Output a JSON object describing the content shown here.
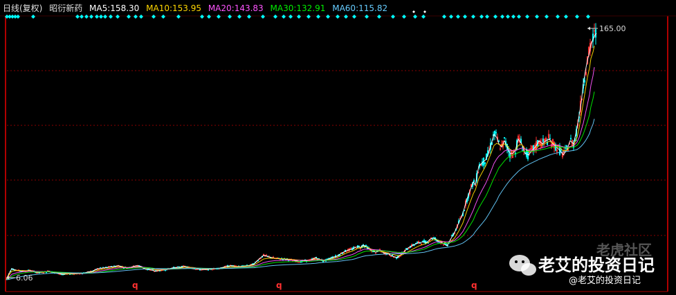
{
  "header": {
    "period_label": "日线(复权)",
    "stock_name": "昭衍新药",
    "ma": [
      {
        "label": "MA5:",
        "value": "158.30",
        "color": "#ffffff"
      },
      {
        "label": "MA10:",
        "value": "153.95",
        "color": "#ffd700"
      },
      {
        "label": "MA20:",
        "value": "143.83",
        "color": "#ff55ff"
      },
      {
        "label": "MA30:",
        "value": "132.91",
        "color": "#00ee00"
      },
      {
        "label": "MA60:",
        "value": "115.82",
        "color": "#66ccff"
      }
    ]
  },
  "price_labels": {
    "high": "165.00",
    "low": "6.06"
  },
  "markers": {
    "q1": "q",
    "q2": "q",
    "q3": "q"
  },
  "watermark": {
    "brand": "老虎社区",
    "title": "老艾的投资日记",
    "handle": "@老艾的投资日记"
  },
  "colors": {
    "background": "#000000",
    "grid": "#8b0000",
    "axis": "#b00000",
    "up": "#ff3030",
    "down": "#00ffff",
    "signal": "#00ffff"
  },
  "chart_data": {
    "type": "line",
    "title": "",
    "xlabel": "",
    "ylabel": "",
    "ylim": [
      0,
      175
    ],
    "grid": true,
    "legend": "top-left",
    "x": [
      0,
      4,
      8,
      15,
      25,
      35,
      45,
      55,
      62,
      70,
      82,
      90,
      100,
      110,
      118,
      125,
      132,
      140,
      148,
      156,
      162,
      170,
      175,
      180,
      188,
      195,
      200,
      207,
      212,
      215,
      222,
      230,
      240,
      250,
      258,
      262,
      270,
      280,
      290,
      300,
      310,
      318,
      325,
      332,
      340,
      350,
      358,
      365,
      372,
      380,
      390,
      405,
      425,
      440,
      447,
      452,
      458,
      463,
      470,
      478,
      485,
      492,
      500,
      505,
      508,
      512,
      516,
      520,
      528,
      534,
      540,
      546,
      552,
      558,
      565,
      572,
      580,
      588,
      596,
      604,
      608,
      612,
      616,
      620,
      624,
      630,
      637,
      642,
      648,
      654,
      660,
      665,
      670,
      675,
      678,
      683,
      688,
      693,
      697,
      701,
      705,
      709,
      712,
      716,
      720,
      724,
      728,
      732,
      736,
      740,
      745,
      750,
      755,
      760,
      765,
      770,
      775,
      780,
      785,
      790,
      795,
      800,
      805,
      810,
      815,
      820,
      825,
      828,
      831,
      834,
      837,
      840,
      843,
      845,
      848,
      850,
      853
    ],
    "series": [
      {
        "name": "MA5",
        "values": [
          6.06,
          10,
          13,
          12,
          11.5,
          12,
          10.5,
          11,
          11.5,
          10.5,
          9.5,
          9.8,
          10,
          10,
          11,
          11.5,
          13,
          13.5,
          14,
          14.5,
          15,
          14,
          13.5,
          14,
          15,
          14.5,
          13,
          12.5,
          12,
          11.5,
          12,
          12.5,
          13.5,
          14,
          14.5,
          14,
          13.5,
          12.5,
          12.5,
          13,
          13.5,
          14.5,
          15,
          14.5,
          14.5,
          15,
          16,
          19,
          21.5,
          20.5,
          19.5,
          19,
          17.5,
          18.5,
          20,
          19,
          18,
          18.5,
          20,
          21,
          23,
          24.5,
          25.5,
          26.5,
          27,
          26.5,
          28,
          27,
          24.5,
          23.5,
          24.5,
          23,
          22.5,
          21,
          20,
          22.5,
          26,
          28,
          29.5,
          30,
          29.5,
          31.5,
          32.5,
          32,
          30.5,
          29.5,
          27.5,
          31.5,
          36,
          42,
          48,
          56,
          62,
          68,
          66,
          78,
          80,
          82,
          86,
          92,
          98,
          96,
          92,
          90,
          94,
          90,
          86,
          86,
          88,
          95,
          92,
          86,
          85,
          88,
          90,
          94,
          92,
          94,
          95,
          92,
          90,
          88,
          85,
          88,
          94,
          92,
          102,
          110,
          118,
          130,
          138,
          145,
          150,
          155,
          158,
          160,
          162
        ]
      },
      {
        "name": "MA10",
        "values": [
          6.06,
          9,
          11.5,
          12,
          11.8,
          11.8,
          11,
          11,
          11.2,
          10.8,
          10,
          9.8,
          9.8,
          10,
          10.5,
          11,
          12,
          12.8,
          13.2,
          13.8,
          14.2,
          14,
          13.8,
          13.8,
          14.2,
          14.2,
          13.6,
          13.2,
          12.8,
          12.4,
          12.2,
          12.4,
          13,
          13.4,
          14,
          14,
          13.8,
          13.2,
          12.9,
          13,
          13.2,
          13.8,
          14.4,
          14.4,
          14.4,
          14.8,
          15.4,
          17.2,
          19.2,
          19.8,
          19.6,
          19.2,
          18.4,
          18.4,
          19.2,
          19,
          18.6,
          18.5,
          19.2,
          20,
          21.6,
          23,
          24.2,
          25.2,
          26,
          26.2,
          27,
          26.8,
          25.4,
          24.4,
          24.2,
          23.6,
          23,
          22.2,
          21.4,
          21.8,
          23.6,
          25.6,
          27.4,
          28.6,
          29.2,
          30.2,
          31.2,
          31.6,
          31,
          30.4,
          29.2,
          30,
          32.4,
          36.8,
          42,
          48.6,
          54.6,
          60.4,
          63,
          70,
          74,
          78,
          82,
          86.4,
          91,
          92.4,
          91.6,
          91,
          92,
          90.8,
          88.6,
          87.4,
          87.6,
          91,
          91.6,
          88.8,
          87,
          87.4,
          88.4,
          91,
          91.4,
          92.6,
          93.6,
          92.6,
          91.2,
          89.6,
          87.6,
          87.8,
          90.2,
          91,
          96,
          102,
          110,
          118,
          126,
          134,
          140,
          146,
          150,
          154
        ]
      },
      {
        "name": "MA20",
        "values": [
          6.06,
          7.5,
          9.5,
          10.5,
          11.2,
          11.5,
          11.3,
          11.2,
          11.2,
          11,
          10.6,
          10.3,
          10.1,
          10,
          10.2,
          10.5,
          11.2,
          11.9,
          12.5,
          13,
          13.5,
          13.7,
          13.7,
          13.8,
          14,
          14.1,
          13.9,
          13.6,
          13.3,
          13,
          12.7,
          12.6,
          12.8,
          13,
          13.3,
          13.5,
          13.6,
          13.4,
          13.2,
          13.1,
          13.1,
          13.4,
          13.7,
          13.9,
          14.1,
          14.3,
          14.7,
          15.7,
          16.9,
          17.7,
          18.2,
          18.4,
          18.3,
          18.3,
          18.6,
          18.7,
          18.6,
          18.5,
          18.7,
          19.1,
          20,
          21,
          22,
          23,
          23.8,
          24.4,
          25.2,
          25.5,
          25.3,
          25,
          24.8,
          24.4,
          24,
          23.5,
          23,
          22.9,
          23.3,
          24.3,
          25.4,
          26.5,
          27.3,
          28.2,
          29.1,
          29.8,
          30.1,
          30.2,
          30,
          30.1,
          31,
          33.3,
          36.6,
          40.8,
          45.3,
          50,
          53.5,
          58.7,
          63,
          67,
          71,
          75.2,
          79.6,
          82.5,
          84.2,
          85.6,
          87.4,
          88.2,
          88,
          87.7,
          87.6,
          88.6,
          89.3,
          88.7,
          88,
          88,
          88.2,
          89,
          89.5,
          90.2,
          90.9,
          91.3,
          91.3,
          90.8,
          90.1,
          89.8,
          90.3,
          90.7,
          93,
          96,
          100.5,
          105,
          111,
          117,
          123,
          129,
          135,
          140.5
        ]
      },
      {
        "name": "MA30",
        "values": [
          6.06,
          6.8,
          8.2,
          9.5,
          10.4,
          10.9,
          11,
          11.1,
          11.1,
          11,
          10.8,
          10.6,
          10.4,
          10.2,
          10.2,
          10.3,
          10.6,
          11.1,
          11.6,
          12.1,
          12.6,
          12.9,
          13.1,
          13.3,
          13.5,
          13.7,
          13.7,
          13.6,
          13.4,
          13.2,
          13,
          12.9,
          12.9,
          13,
          13.1,
          13.3,
          13.4,
          13.4,
          13.3,
          13.2,
          13.2,
          13.3,
          13.5,
          13.7,
          13.8,
          14,
          14.3,
          14.9,
          15.7,
          16.4,
          17,
          17.4,
          17.6,
          17.8,
          18,
          18.2,
          18.3,
          18.3,
          18.4,
          18.6,
          19.1,
          19.8,
          20.6,
          21.4,
          22.2,
          22.9,
          23.6,
          24.1,
          24.3,
          24.4,
          24.4,
          24.3,
          24.1,
          23.8,
          23.5,
          23.3,
          23.4,
          23.9,
          24.6,
          25.4,
          26.2,
          27,
          27.8,
          28.5,
          28.9,
          29.2,
          29.3,
          29.6,
          30.2,
          31.6,
          33.8,
          36.8,
          40.2,
          43.8,
          47,
          51.4,
          55.2,
          58.8,
          62.5,
          66.5,
          70.5,
          74,
          76.8,
          79,
          81.2,
          83,
          84.2,
          85,
          85.5,
          86.4,
          87.2,
          87.3,
          87.3,
          87.4,
          87.5,
          88,
          88.4,
          88.9,
          89.5,
          90,
          90.2,
          90.1,
          89.8,
          89.6,
          89.7,
          89.9,
          91,
          92.7,
          95.3,
          98.2,
          102,
          106,
          110.5,
          115.5,
          120.5,
          125
        ]
      },
      {
        "name": "MA60",
        "values": [
          6.06,
          6.3,
          6.8,
          7.5,
          8.3,
          9,
          9.5,
          9.9,
          10.1,
          10.3,
          10.4,
          10.4,
          10.4,
          10.4,
          10.4,
          10.4,
          10.5,
          10.7,
          10.9,
          11.2,
          11.5,
          11.8,
          12,
          12.2,
          12.5,
          12.7,
          12.9,
          13,
          13.1,
          13.1,
          13.1,
          13.1,
          13.1,
          13.1,
          13.1,
          13.2,
          13.2,
          13.2,
          13.2,
          13.2,
          13.2,
          13.3,
          13.3,
          13.4,
          13.5,
          13.6,
          13.7,
          14,
          14.4,
          14.8,
          15.2,
          15.6,
          15.9,
          16.2,
          16.5,
          16.8,
          17,
          17.2,
          17.4,
          17.6,
          18,
          18.4,
          18.9,
          19.4,
          19.9,
          20.4,
          20.9,
          21.3,
          21.6,
          21.9,
          22.1,
          22.3,
          22.4,
          22.5,
          22.5,
          22.5,
          22.6,
          22.8,
          23.1,
          23.5,
          23.9,
          24.4,
          24.9,
          25.4,
          25.8,
          26.2,
          26.5,
          26.9,
          27.4,
          28.2,
          29.3,
          30.8,
          32.5,
          34.5,
          36.5,
          39.2,
          41.8,
          44.5,
          47.3,
          50.3,
          53.3,
          56.2,
          59,
          61.7,
          64.3,
          66.8,
          69,
          71,
          72.8,
          74.6,
          76.4,
          77.8,
          79,
          80.1,
          81.1,
          82.2,
          83.1,
          84,
          84.9,
          85.6,
          86.2,
          86.6,
          86.9,
          87.2,
          87.5,
          87.8,
          88.4,
          89.3,
          90.5,
          92,
          93.8,
          96,
          98.5,
          101.3,
          104.4,
          107.8
        ]
      }
    ],
    "annotations": [
      {
        "text": "165.00",
        "x": 850,
        "y": 165
      },
      {
        "text": "6.06",
        "x": 8,
        "y": 6.06
      }
    ]
  }
}
